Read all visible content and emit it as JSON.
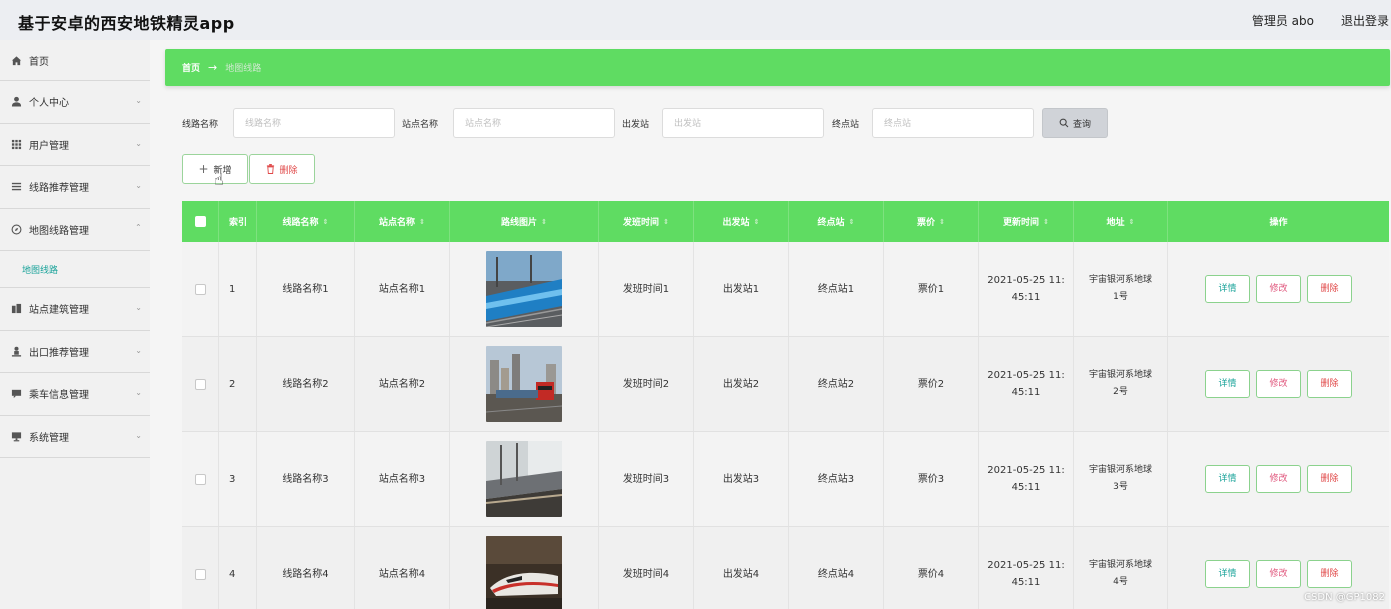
{
  "header": {
    "app_title": "基于安卓的西安地铁精灵app",
    "admin_label": "管理员 abo",
    "logout_label": "退出登录"
  },
  "sidebar": {
    "items": [
      {
        "label": "首页",
        "icon": "home-icon",
        "expandable": false
      },
      {
        "label": "个人中心",
        "icon": "user-icon",
        "expandable": true
      },
      {
        "label": "用户管理",
        "icon": "grid-icon",
        "expandable": true
      },
      {
        "label": "线路推荐管理",
        "icon": "list-icon",
        "expandable": true
      },
      {
        "label": "地图线路管理",
        "icon": "compass-icon",
        "expandable": true,
        "expanded": true,
        "children": [
          "地图线路"
        ]
      },
      {
        "label": "站点建筑管理",
        "icon": "building-icon",
        "expandable": true
      },
      {
        "label": "出口推荐管理",
        "icon": "person-icon",
        "expandable": true
      },
      {
        "label": "乘车信息管理",
        "icon": "message-icon",
        "expandable": true
      },
      {
        "label": "系统管理",
        "icon": "monitor-icon",
        "expandable": true
      }
    ]
  },
  "breadcrumb": {
    "home": "首页",
    "separator": "→",
    "current": "地图线路"
  },
  "search": {
    "fields": [
      {
        "label": "线路名称",
        "placeholder": "线路名称"
      },
      {
        "label": "站点名称",
        "placeholder": "站点名称"
      },
      {
        "label": "出发站",
        "placeholder": "出发站"
      },
      {
        "label": "终点站",
        "placeholder": "终点站"
      }
    ],
    "button_label": "查询"
  },
  "actions": {
    "add_label": "新增",
    "delete_label": "删除"
  },
  "table": {
    "columns": [
      "索引",
      "线路名称",
      "站点名称",
      "路线图片",
      "发班时间",
      "出发站",
      "终点站",
      "票价",
      "更新时间",
      "地址",
      "操作"
    ],
    "rows": [
      {
        "index": "1",
        "route_name": "线路名称1",
        "station_name": "站点名称1",
        "depart_time": "发班时间1",
        "start_station": "出发站1",
        "end_station": "终点站1",
        "price": "票价1",
        "updated": "2021-05-25 11:45:11",
        "updated_line1": "2021-05-25 11:",
        "updated_line2": "45:11",
        "address_line1": "宇宙银河系地球",
        "address_line2": "1号",
        "image": "blue-train-photo"
      },
      {
        "index": "2",
        "route_name": "线路名称2",
        "station_name": "站点名称2",
        "depart_time": "发班时间2",
        "start_station": "出发站2",
        "end_station": "终点站2",
        "price": "票价2",
        "updated": "2021-05-25 11:45:11",
        "updated_line1": "2021-05-25 11:",
        "updated_line2": "45:11",
        "address_line1": "宇宙银河系地球",
        "address_line2": "2号",
        "image": "red-locomotive-city-photo"
      },
      {
        "index": "3",
        "route_name": "线路名称3",
        "station_name": "站点名称3",
        "depart_time": "发班时间3",
        "start_station": "出发站3",
        "end_station": "终点站3",
        "price": "票价3",
        "updated": "2021-05-25 11:45:11",
        "updated_line1": "2021-05-25 11:",
        "updated_line2": "45:11",
        "address_line1": "宇宙银河系地球",
        "address_line2": "3号",
        "image": "train-station-platform-photo"
      },
      {
        "index": "4",
        "route_name": "线路名称4",
        "station_name": "站点名称4",
        "depart_time": "发班时间4",
        "start_station": "出发站4",
        "end_station": "终点站4",
        "price": "票价4",
        "updated": "2021-05-25 11:45:11",
        "updated_line1": "2021-05-25 11:",
        "updated_line2": "45:11",
        "address_line1": "宇宙银河系地球",
        "address_line2": "4号",
        "image": "high-speed-train-photo"
      }
    ],
    "row_actions": {
      "detail": "详情",
      "edit": "修改",
      "remove": "删除"
    }
  },
  "watermark": "CSDN @GP1082",
  "colors": {
    "accent_green": "#5fdc62",
    "link_teal": "#1aa39a",
    "danger_red": "#e04848",
    "edit_pink": "#e0567c"
  }
}
